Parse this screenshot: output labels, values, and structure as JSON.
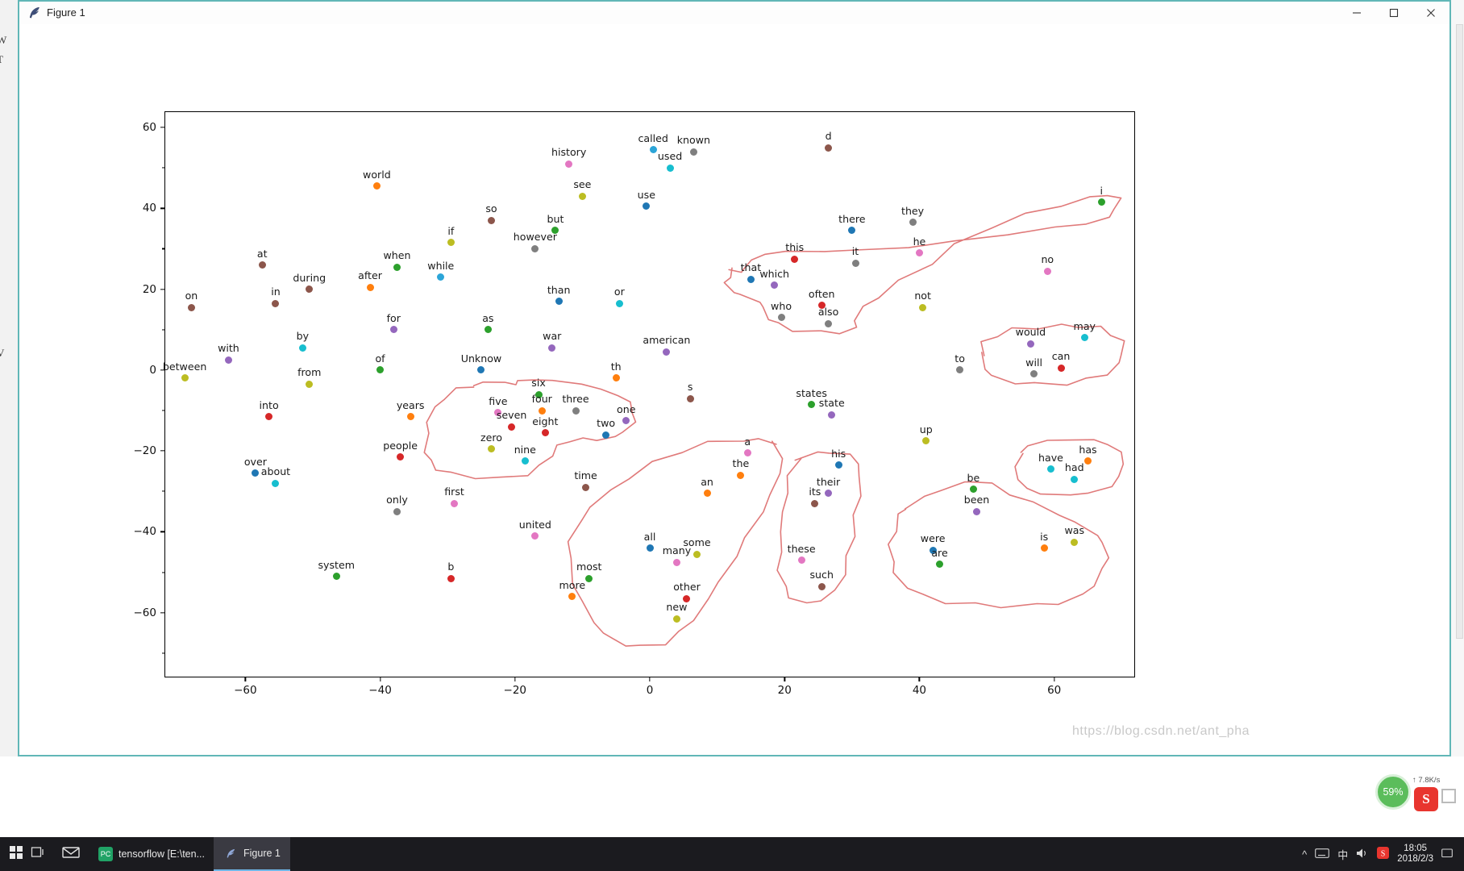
{
  "window": {
    "title": "Figure 1",
    "app_icon": "feather-icon",
    "minimize_label": "Minimize",
    "maximize_label": "Maximize",
    "close_label": "Close"
  },
  "watermark": "https://blog.csdn.net/ant_pha",
  "float_widget": {
    "percent": "59%",
    "speed_up": "↑",
    "speed_value": "7.8K/s",
    "logo": "S"
  },
  "taskbar": {
    "items": [
      {
        "name": "start-button",
        "glyph": "⊞"
      },
      {
        "name": "task-view-button",
        "glyph": "❏"
      },
      {
        "name": "mail-button",
        "glyph": "✉"
      }
    ],
    "apps": [
      {
        "name": "taskbar-app-pycharm",
        "label": "tensorflow [E:\\ten...",
        "badge": "PC",
        "badge_color": "#21a366",
        "active": false
      },
      {
        "name": "taskbar-app-figure",
        "label": "Figure 1",
        "badge": "",
        "badge_color": "#4a6fa5",
        "active": true
      }
    ],
    "tray": [
      "^",
      "⌨",
      "中",
      "🔊"
    ],
    "clock_time": "18:05",
    "clock_date": "2018/2/3"
  },
  "chart_data": {
    "type": "scatter",
    "title": "",
    "xlabel": "",
    "ylabel": "",
    "xlim": [
      -72,
      72
    ],
    "ylim": [
      -76,
      64
    ],
    "grid": false,
    "legend": null,
    "xticks": [
      -60,
      -40,
      -20,
      0,
      20,
      40,
      60
    ],
    "yticks": [
      -60,
      -40,
      -20,
      0,
      20,
      40,
      60
    ],
    "annotation_note": "hand-drawn red lasso outlines grouping semantic clusters",
    "annotation_color": "#e07a7a",
    "points": [
      {
        "label": "called",
        "x": 0.5,
        "y": 54.5,
        "color": "#2ca5d8"
      },
      {
        "label": "known",
        "x": 6.5,
        "y": 54.0,
        "color": "#7f7f7f"
      },
      {
        "label": "d",
        "x": 26.5,
        "y": 55.0,
        "color": "#8c564b"
      },
      {
        "label": "history",
        "x": -12.0,
        "y": 51.0,
        "color": "#e377c2"
      },
      {
        "label": "used",
        "x": 3.0,
        "y": 50.0,
        "color": "#17becf"
      },
      {
        "label": "world",
        "x": -40.5,
        "y": 45.5,
        "color": "#ff7f0e"
      },
      {
        "label": "see",
        "x": -10.0,
        "y": 43.0,
        "color": "#bcbd22"
      },
      {
        "label": "i",
        "x": 67.0,
        "y": 41.5,
        "color": "#2ca02c"
      },
      {
        "label": "use",
        "x": -0.5,
        "y": 40.5,
        "color": "#1f77b4"
      },
      {
        "label": "so",
        "x": -23.5,
        "y": 37.0,
        "color": "#8c564b"
      },
      {
        "label": "they",
        "x": 39.0,
        "y": 36.5,
        "color": "#7f7f7f"
      },
      {
        "label": "but",
        "x": -14.0,
        "y": 34.5,
        "color": "#2ca02c"
      },
      {
        "label": "there",
        "x": 30.0,
        "y": 34.5,
        "color": "#1f77b4"
      },
      {
        "label": "if",
        "x": -29.5,
        "y": 31.5,
        "color": "#bcbd22"
      },
      {
        "label": "however",
        "x": -17.0,
        "y": 30.0,
        "color": "#7f7f7f"
      },
      {
        "label": "he",
        "x": 40.0,
        "y": 29.0,
        "color": "#e377c2"
      },
      {
        "label": "this",
        "x": 21.5,
        "y": 27.5,
        "color": "#d62728"
      },
      {
        "label": "it",
        "x": 30.5,
        "y": 26.5,
        "color": "#7f7f7f"
      },
      {
        "label": "at",
        "x": -57.5,
        "y": 26.0,
        "color": "#8c564b"
      },
      {
        "label": "when",
        "x": -37.5,
        "y": 25.5,
        "color": "#2ca02c"
      },
      {
        "label": "no",
        "x": 59.0,
        "y": 24.5,
        "color": "#e377c2"
      },
      {
        "label": "while",
        "x": -31.0,
        "y": 23.0,
        "color": "#2ca5d8"
      },
      {
        "label": "that",
        "x": 15.0,
        "y": 22.5,
        "color": "#1f77b4"
      },
      {
        "label": "which",
        "x": 18.5,
        "y": 21.0,
        "color": "#9467bd"
      },
      {
        "label": "after",
        "x": -41.5,
        "y": 20.5,
        "color": "#ff7f0e"
      },
      {
        "label": "during",
        "x": -50.5,
        "y": 20.0,
        "color": "#8c564b"
      },
      {
        "label": "than",
        "x": -13.5,
        "y": 17.0,
        "color": "#1f77b4"
      },
      {
        "label": "or",
        "x": -4.5,
        "y": 16.5,
        "color": "#17becf"
      },
      {
        "label": "in",
        "x": -55.5,
        "y": 16.5,
        "color": "#8c564b"
      },
      {
        "label": "often",
        "x": 25.5,
        "y": 16.0,
        "color": "#d62728"
      },
      {
        "label": "on",
        "x": -68.0,
        "y": 15.5,
        "color": "#8c564b"
      },
      {
        "label": "not",
        "x": 40.5,
        "y": 15.5,
        "color": "#bcbd22"
      },
      {
        "label": "who",
        "x": 19.5,
        "y": 13.0,
        "color": "#7f7f7f"
      },
      {
        "label": "also",
        "x": 26.5,
        "y": 11.5,
        "color": "#7f7f7f"
      },
      {
        "label": "for",
        "x": -38.0,
        "y": 10.0,
        "color": "#9467bd"
      },
      {
        "label": "as",
        "x": -24.0,
        "y": 10.0,
        "color": "#2ca02c"
      },
      {
        "label": "may",
        "x": 64.5,
        "y": 8.0,
        "color": "#17becf"
      },
      {
        "label": "would",
        "x": 56.5,
        "y": 6.5,
        "color": "#9467bd"
      },
      {
        "label": "by",
        "x": -51.5,
        "y": 5.5,
        "color": "#17becf"
      },
      {
        "label": "war",
        "x": -14.5,
        "y": 5.5,
        "color": "#9467bd"
      },
      {
        "label": "american",
        "x": 2.5,
        "y": 4.5,
        "color": "#9467bd"
      },
      {
        "label": "with",
        "x": -62.5,
        "y": 2.5,
        "color": "#9467bd"
      },
      {
        "label": "can",
        "x": 61.0,
        "y": 0.5,
        "color": "#d62728"
      },
      {
        "label": "of",
        "x": -40.0,
        "y": 0.0,
        "color": "#2ca02c"
      },
      {
        "label": "Unknow",
        "x": -25.0,
        "y": 0.0,
        "color": "#1f77b4"
      },
      {
        "label": "to",
        "x": 46.0,
        "y": 0.0,
        "color": "#7f7f7f"
      },
      {
        "label": "will",
        "x": 57.0,
        "y": -1.0,
        "color": "#7f7f7f"
      },
      {
        "label": "between",
        "x": -69.0,
        "y": -2.0,
        "color": "#bcbd22"
      },
      {
        "label": "th",
        "x": -5.0,
        "y": -2.0,
        "color": "#ff7f0e"
      },
      {
        "label": "from",
        "x": -50.5,
        "y": -3.5,
        "color": "#bcbd22"
      },
      {
        "label": "six",
        "x": -16.5,
        "y": -6.0,
        "color": "#2ca02c"
      },
      {
        "label": "s",
        "x": 6.0,
        "y": -7.0,
        "color": "#8c564b"
      },
      {
        "label": "states",
        "x": 24.0,
        "y": -8.5,
        "color": "#2ca02c"
      },
      {
        "label": "five",
        "x": -22.5,
        "y": -10.5,
        "color": "#e377c2"
      },
      {
        "label": "four",
        "x": -16.0,
        "y": -10.0,
        "color": "#ff7f0e"
      },
      {
        "label": "three",
        "x": -11.0,
        "y": -10.0,
        "color": "#7f7f7f"
      },
      {
        "label": "state",
        "x": 27.0,
        "y": -11.0,
        "color": "#9467bd"
      },
      {
        "label": "into",
        "x": -56.5,
        "y": -11.5,
        "color": "#d62728"
      },
      {
        "label": "years",
        "x": -35.5,
        "y": -11.5,
        "color": "#ff7f0e"
      },
      {
        "label": "one",
        "x": -3.5,
        "y": -12.5,
        "color": "#9467bd"
      },
      {
        "label": "seven",
        "x": -20.5,
        "y": -14.0,
        "color": "#d62728"
      },
      {
        "label": "eight",
        "x": -15.5,
        "y": -15.5,
        "color": "#d62728"
      },
      {
        "label": "two",
        "x": -6.5,
        "y": -16.0,
        "color": "#1f77b4"
      },
      {
        "label": "up",
        "x": 41.0,
        "y": -17.5,
        "color": "#bcbd22"
      },
      {
        "label": "zero",
        "x": -23.5,
        "y": -19.5,
        "color": "#bcbd22"
      },
      {
        "label": "a",
        "x": 14.5,
        "y": -20.5,
        "color": "#e377c2"
      },
      {
        "label": "people",
        "x": -37.0,
        "y": -21.5,
        "color": "#d62728"
      },
      {
        "label": "nine",
        "x": -18.5,
        "y": -22.5,
        "color": "#17becf"
      },
      {
        "label": "has",
        "x": 65.0,
        "y": -22.5,
        "color": "#ff7f0e"
      },
      {
        "label": "his",
        "x": 28.0,
        "y": -23.5,
        "color": "#1f77b4"
      },
      {
        "label": "have",
        "x": 59.5,
        "y": -24.5,
        "color": "#17becf"
      },
      {
        "label": "over",
        "x": -58.5,
        "y": -25.5,
        "color": "#1f77b4"
      },
      {
        "label": "the",
        "x": 13.5,
        "y": -26.0,
        "color": "#ff7f0e"
      },
      {
        "label": "had",
        "x": 63.0,
        "y": -27.0,
        "color": "#17becf"
      },
      {
        "label": "about",
        "x": -55.5,
        "y": -28.0,
        "color": "#17becf"
      },
      {
        "label": "time",
        "x": -9.5,
        "y": -29.0,
        "color": "#8c564b"
      },
      {
        "label": "be",
        "x": 48.0,
        "y": -29.5,
        "color": "#2ca02c"
      },
      {
        "label": "an",
        "x": 8.5,
        "y": -30.5,
        "color": "#ff7f0e"
      },
      {
        "label": "their",
        "x": 26.5,
        "y": -30.5,
        "color": "#9467bd"
      },
      {
        "label": "its",
        "x": 24.5,
        "y": -33.0,
        "color": "#8c564b"
      },
      {
        "label": "first",
        "x": -29.0,
        "y": -33.0,
        "color": "#e377c2"
      },
      {
        "label": "only",
        "x": -37.5,
        "y": -35.0,
        "color": "#7f7f7f"
      },
      {
        "label": "been",
        "x": 48.5,
        "y": -35.0,
        "color": "#9467bd"
      },
      {
        "label": "united",
        "x": -17.0,
        "y": -41.0,
        "color": "#e377c2"
      },
      {
        "label": "was",
        "x": 63.0,
        "y": -42.5,
        "color": "#bcbd22"
      },
      {
        "label": "is",
        "x": 58.5,
        "y": -44.0,
        "color": "#ff7f0e"
      },
      {
        "label": "all",
        "x": 0.0,
        "y": -44.0,
        "color": "#1f77b4"
      },
      {
        "label": "were",
        "x": 42.0,
        "y": -44.5,
        "color": "#1f77b4"
      },
      {
        "label": "some",
        "x": 7.0,
        "y": -45.5,
        "color": "#bcbd22"
      },
      {
        "label": "many",
        "x": 4.0,
        "y": -47.5,
        "color": "#e377c2"
      },
      {
        "label": "these",
        "x": 22.5,
        "y": -47.0,
        "color": "#e377c2"
      },
      {
        "label": "are",
        "x": 43.0,
        "y": -48.0,
        "color": "#2ca02c"
      },
      {
        "label": "system",
        "x": -46.5,
        "y": -51.0,
        "color": "#2ca02c"
      },
      {
        "label": "b",
        "x": -29.5,
        "y": -51.5,
        "color": "#d62728"
      },
      {
        "label": "most",
        "x": -9.0,
        "y": -51.5,
        "color": "#2ca02c"
      },
      {
        "label": "such",
        "x": 25.5,
        "y": -53.5,
        "color": "#8c564b"
      },
      {
        "label": "more",
        "x": -11.5,
        "y": -56.0,
        "color": "#ff7f0e"
      },
      {
        "label": "other",
        "x": 5.5,
        "y": -56.5,
        "color": "#d62728"
      },
      {
        "label": "new",
        "x": 4.0,
        "y": -61.5,
        "color": "#bcbd22"
      }
    ],
    "clusters": [
      {
        "name": "pronoun-determiner-cluster",
        "members": [
          "that",
          "which",
          "this",
          "it",
          "there",
          "they",
          "he",
          "i",
          "often",
          "also",
          "who"
        ]
      },
      {
        "name": "number-cluster",
        "members": [
          "six",
          "five",
          "four",
          "three",
          "seven",
          "eight",
          "two",
          "one",
          "nine",
          "zero"
        ]
      },
      {
        "name": "modal-cluster",
        "members": [
          "would",
          "will",
          "may",
          "can"
        ]
      },
      {
        "name": "have-cluster",
        "members": [
          "have",
          "has",
          "had"
        ]
      },
      {
        "name": "quantifier-cluster",
        "members": [
          "a",
          "the",
          "an",
          "all",
          "some",
          "many",
          "most",
          "more",
          "other",
          "new"
        ]
      },
      {
        "name": "possessive-cluster",
        "members": [
          "his",
          "their",
          "its",
          "these",
          "such"
        ]
      },
      {
        "name": "be-verb-cluster",
        "members": [
          "be",
          "been",
          "were",
          "are",
          "is",
          "was"
        ]
      }
    ]
  }
}
